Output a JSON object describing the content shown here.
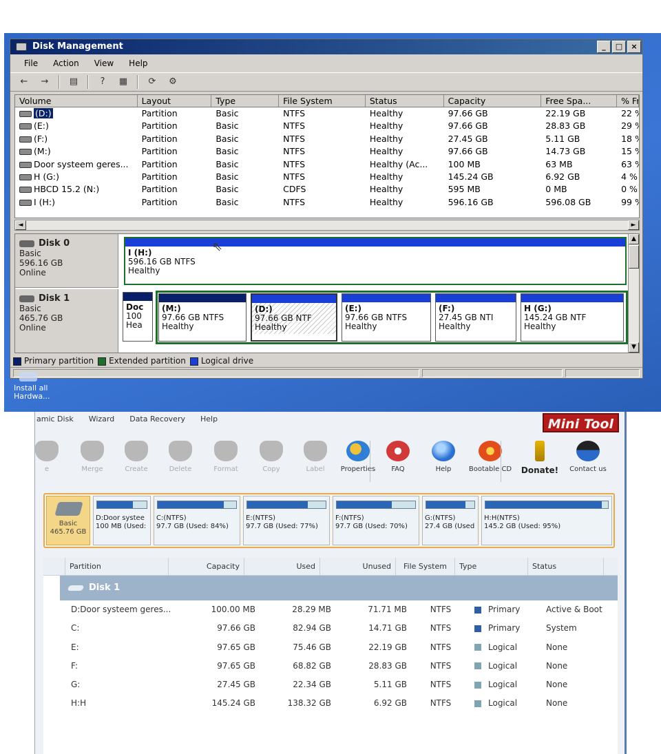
{
  "disk_management": {
    "window_title": "Disk Management",
    "window_buttons": {
      "minimize": "_",
      "maximize": "□",
      "close": "×"
    },
    "menu": [
      "File",
      "Action",
      "View",
      "Help"
    ],
    "toolbar_icons": [
      "back-icon",
      "forward-icon",
      "console-icon",
      "help-icon",
      "properties-icon",
      "refresh-icon",
      "settings-icon"
    ],
    "columns": [
      "Volume",
      "Layout",
      "Type",
      "File System",
      "Status",
      "Capacity",
      "Free Spa...",
      "% Fre"
    ],
    "volumes": [
      {
        "volume": "(D:)",
        "layout": "Partition",
        "type": "Basic",
        "fs": "NTFS",
        "status": "Healthy",
        "capacity": "97.66 GB",
        "free": "22.19 GB",
        "pct": "22 %"
      },
      {
        "volume": "(E:)",
        "layout": "Partition",
        "type": "Basic",
        "fs": "NTFS",
        "status": "Healthy",
        "capacity": "97.66 GB",
        "free": "28.83 GB",
        "pct": "29 %"
      },
      {
        "volume": "(F:)",
        "layout": "Partition",
        "type": "Basic",
        "fs": "NTFS",
        "status": "Healthy",
        "capacity": "27.45 GB",
        "free": "5.11 GB",
        "pct": "18 %"
      },
      {
        "volume": "(M:)",
        "layout": "Partition",
        "type": "Basic",
        "fs": "NTFS",
        "status": "Healthy",
        "capacity": "97.66 GB",
        "free": "14.73 GB",
        "pct": "15 %"
      },
      {
        "volume": "Door systeem geres...",
        "layout": "Partition",
        "type": "Basic",
        "fs": "NTFS",
        "status": "Healthy (Ac...",
        "capacity": "100 MB",
        "free": "63 MB",
        "pct": "63 %"
      },
      {
        "volume": "H (G:)",
        "layout": "Partition",
        "type": "Basic",
        "fs": "NTFS",
        "status": "Healthy",
        "capacity": "145.24 GB",
        "free": "6.92 GB",
        "pct": "4 %"
      },
      {
        "volume": "HBCD 15.2 (N:)",
        "layout": "Partition",
        "type": "Basic",
        "fs": "CDFS",
        "status": "Healthy",
        "capacity": "595 MB",
        "free": "0 MB",
        "pct": "0 %"
      },
      {
        "volume": "I (H:)",
        "layout": "Partition",
        "type": "Basic",
        "fs": "NTFS",
        "status": "Healthy",
        "capacity": "596.16 GB",
        "free": "596.08 GB",
        "pct": "99 %"
      }
    ],
    "disks": [
      {
        "name": "Disk 0",
        "kind": "Basic",
        "size": "596.16 GB",
        "state": "Online",
        "partitions": [
          {
            "name": "I  (H:)",
            "size": "596.16 GB NTFS",
            "status": "Healthy"
          }
        ]
      },
      {
        "name": "Disk 1",
        "kind": "Basic",
        "size": "465.76 GB",
        "state": "Online",
        "partitions": [
          {
            "name": "Doc",
            "size": "100",
            "status": "Hea"
          },
          {
            "name": "(M:)",
            "size": "97.66 GB NTFS",
            "status": "Healthy"
          },
          {
            "name": "(D:)",
            "size": "97.66 GB NTF",
            "status": "Healthy"
          },
          {
            "name": "(E:)",
            "size": "97.66 GB NTFS",
            "status": "Healthy"
          },
          {
            "name": "(F:)",
            "size": "27.45 GB NTI",
            "status": "Healthy"
          },
          {
            "name": "H  (G:)",
            "size": "145.24 GB NTF",
            "status": "Healthy"
          }
        ]
      }
    ],
    "legend": [
      {
        "label": "Primary partition",
        "color": "#0a1f6a"
      },
      {
        "label": "Extended partition",
        "color": "#1e6f2c"
      },
      {
        "label": "Logical drive",
        "color": "#1a3fd6"
      }
    ],
    "desktop_icon": {
      "line1": "Install all",
      "line2": "Hardwa..."
    }
  },
  "minitool": {
    "menu": [
      "amic Disk",
      "Wizard",
      "Data Recovery",
      "Help"
    ],
    "brand": {
      "left": "Mini",
      "right": "Tool"
    },
    "toolbar": [
      {
        "label": "e",
        "icon": "cut-icon",
        "enabled": false
      },
      {
        "label": "Merge",
        "icon": "merge-icon",
        "enabled": false
      },
      {
        "label": "Create",
        "icon": "create-icon",
        "enabled": false
      },
      {
        "label": "Delete",
        "icon": "delete-icon",
        "enabled": false
      },
      {
        "label": "Format",
        "icon": "format-icon",
        "enabled": false
      },
      {
        "label": "Copy",
        "icon": "copy-icon",
        "enabled": false
      },
      {
        "label": "Label",
        "icon": "label-icon",
        "enabled": false
      },
      {
        "label": "Properties",
        "icon": "properties-icon",
        "enabled": true
      },
      {
        "label": "FAQ",
        "icon": "faq-icon",
        "enabled": true
      },
      {
        "label": "Help",
        "icon": "help-icon",
        "enabled": true
      },
      {
        "label": "Bootable CD",
        "icon": "bootable-cd-icon",
        "enabled": true
      },
      {
        "label": "Donate!",
        "icon": "donate-icon",
        "enabled": true
      },
      {
        "label": "Contact us",
        "icon": "contact-icon",
        "enabled": true
      }
    ],
    "disk_map": {
      "basic": {
        "line1": "Basic",
        "line2": "465.76 GB"
      },
      "partitions": [
        {
          "line1": "D:Door systee",
          "line2": "100 MB (Used:",
          "used_pct": 72
        },
        {
          "line1": "C:(NTFS)",
          "line2": "97.7 GB (Used: 84%)",
          "used_pct": 84
        },
        {
          "line1": "E:(NTFS)",
          "line2": "97.7 GB (Used: 77%)",
          "used_pct": 77
        },
        {
          "line1": "F:(NTFS)",
          "line2": "97.7 GB (Used: 70%)",
          "used_pct": 70
        },
        {
          "line1": "G:(NTFS)",
          "line2": "27.4 GB (Used",
          "used_pct": 81
        },
        {
          "line1": "H:H(NTFS)",
          "line2": "145.2 GB (Used: 95%)",
          "used_pct": 95
        }
      ]
    },
    "columns": [
      "Partition",
      "Capacity",
      "Used",
      "Unused",
      "File System",
      "Type",
      "Status"
    ],
    "disk_label": "Disk 1",
    "rows": [
      {
        "partition": "D:Door systeem geres...",
        "capacity": "100.00 MB",
        "used": "28.29 MB",
        "unused": "71.71 MB",
        "fs": "NTFS",
        "type": "Primary",
        "status": "Active & Boot",
        "type_color": "#2f5ea8"
      },
      {
        "partition": "C:",
        "capacity": "97.66 GB",
        "used": "82.94 GB",
        "unused": "14.71 GB",
        "fs": "NTFS",
        "type": "Primary",
        "status": "System",
        "type_color": "#2f5ea8"
      },
      {
        "partition": "E:",
        "capacity": "97.65 GB",
        "used": "75.46 GB",
        "unused": "22.19 GB",
        "fs": "NTFS",
        "type": "Logical",
        "status": "None",
        "type_color": "#7fa4b3"
      },
      {
        "partition": "F:",
        "capacity": "97.65 GB",
        "used": "68.82 GB",
        "unused": "28.83 GB",
        "fs": "NTFS",
        "type": "Logical",
        "status": "None",
        "type_color": "#7fa4b3"
      },
      {
        "partition": "G:",
        "capacity": "27.45 GB",
        "used": "22.34 GB",
        "unused": "5.11 GB",
        "fs": "NTFS",
        "type": "Logical",
        "status": "None",
        "type_color": "#7fa4b3"
      },
      {
        "partition": "H:H",
        "capacity": "145.24 GB",
        "used": "138.32 GB",
        "unused": "6.92 GB",
        "fs": "NTFS",
        "type": "Logical",
        "status": "None",
        "type_color": "#7fa4b3"
      }
    ]
  }
}
